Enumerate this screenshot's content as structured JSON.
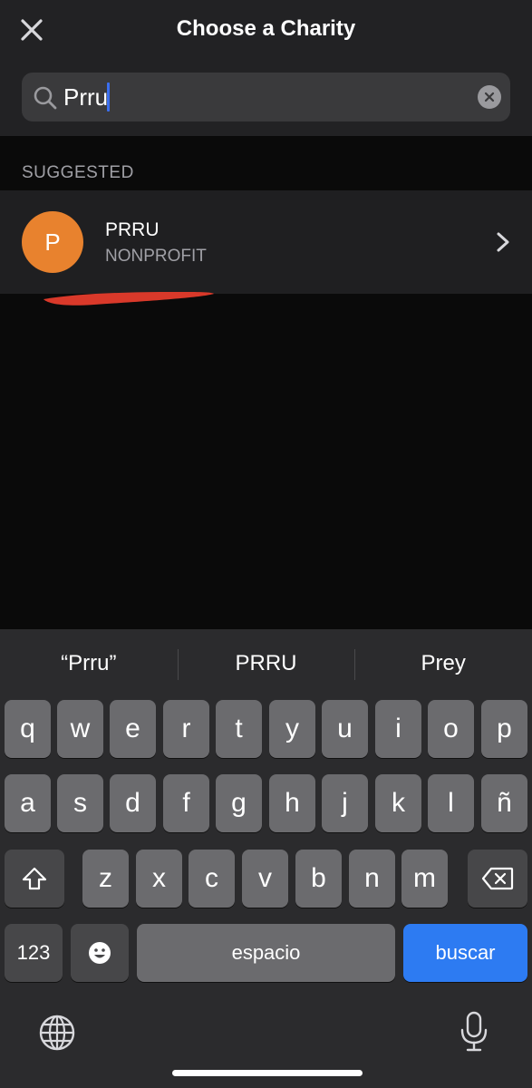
{
  "header": {
    "title": "Choose a Charity",
    "close_icon": "close-icon"
  },
  "search": {
    "value": "Prru",
    "placeholder": "",
    "search_icon": "search-icon",
    "clear_icon": "clear-icon"
  },
  "section": {
    "label": "SUGGESTED"
  },
  "results": [
    {
      "avatar_letter": "P",
      "avatar_color": "#e8822e",
      "name": "PRRU",
      "type": "NONPROFIT"
    }
  ],
  "keyboard": {
    "suggestions": [
      "“Prru”",
      "PRRU",
      "Prey"
    ],
    "row1": [
      "q",
      "w",
      "e",
      "r",
      "t",
      "y",
      "u",
      "i",
      "o",
      "p"
    ],
    "row2": [
      "a",
      "s",
      "d",
      "f",
      "g",
      "h",
      "j",
      "k",
      "l",
      "ñ"
    ],
    "row3": [
      "z",
      "x",
      "c",
      "v",
      "b",
      "n",
      "m"
    ],
    "numbers_label": "123",
    "space_label": "espacio",
    "action_label": "buscar",
    "action_color": "#2d7bf2"
  }
}
